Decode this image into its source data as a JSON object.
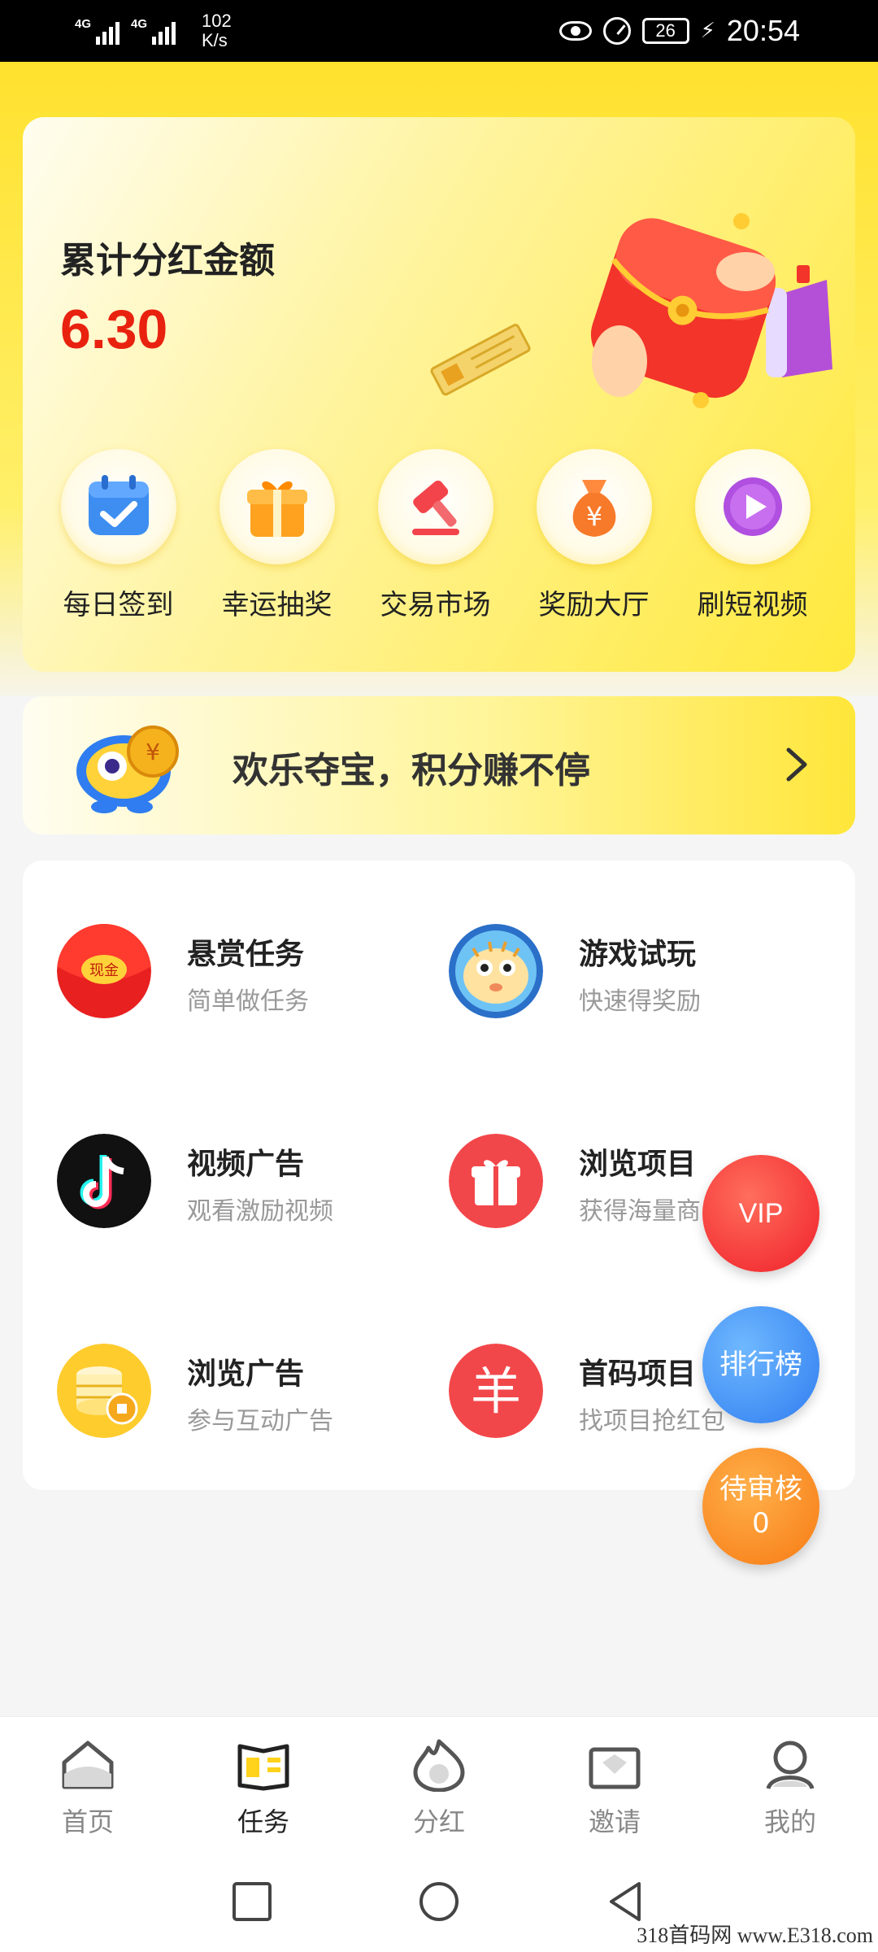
{
  "status_bar": {
    "network1": "4G",
    "network2": "4G",
    "speed_value": "102",
    "speed_unit": "K/s",
    "battery": "26",
    "time": "20:54"
  },
  "hero": {
    "title": "累计分红金额",
    "amount": "6.30"
  },
  "quick_actions": [
    {
      "label": "每日签到",
      "icon": "calendar-check-icon",
      "color": "#3d8ef0"
    },
    {
      "label": "幸运抽奖",
      "icon": "gift-icon",
      "color": "#ff9a1f"
    },
    {
      "label": "交易市场",
      "icon": "gavel-icon",
      "color": "#f2444a"
    },
    {
      "label": "奖励大厅",
      "icon": "money-bag-icon",
      "color": "#f77a2a"
    },
    {
      "label": "刷短视频",
      "icon": "play-icon",
      "color": "#b04fe0"
    }
  ],
  "banner": {
    "text": "欢乐夺宝，积分赚不停"
  },
  "tasks": [
    {
      "title": "悬赏任务",
      "subtitle": "简单做任务",
      "icon": "red-envelope-icon",
      "icon_text": "现金"
    },
    {
      "title": "游戏试玩",
      "subtitle": "快速得奖励",
      "icon": "pufferfish-game-icon"
    },
    {
      "title": "视频广告",
      "subtitle": "观看激励视频",
      "icon": "tiktok-icon"
    },
    {
      "title": "浏览项目",
      "subtitle": "获得海量商",
      "icon": "gift-box-icon"
    },
    {
      "title": "浏览广告",
      "subtitle": "参与互动广告",
      "icon": "coin-stack-icon"
    },
    {
      "title": "首码项目",
      "subtitle": "找项目抢红包",
      "icon": "yuan-icon",
      "icon_text": "羊"
    }
  ],
  "floating": {
    "vip": "VIP",
    "rank": "排行榜",
    "review_label": "待审核",
    "review_count": "0"
  },
  "bottom_nav": [
    {
      "label": "首页",
      "icon": "home-icon"
    },
    {
      "label": "任务",
      "icon": "task-book-icon",
      "active": true
    },
    {
      "label": "分红",
      "icon": "flame-icon"
    },
    {
      "label": "邀请",
      "icon": "envelope-icon"
    },
    {
      "label": "我的",
      "icon": "profile-icon"
    }
  ],
  "watermark": "318首码网 www.E318.com",
  "colors": {
    "brand_yellow": "#ffe12e",
    "amount_red": "#e8220f"
  }
}
